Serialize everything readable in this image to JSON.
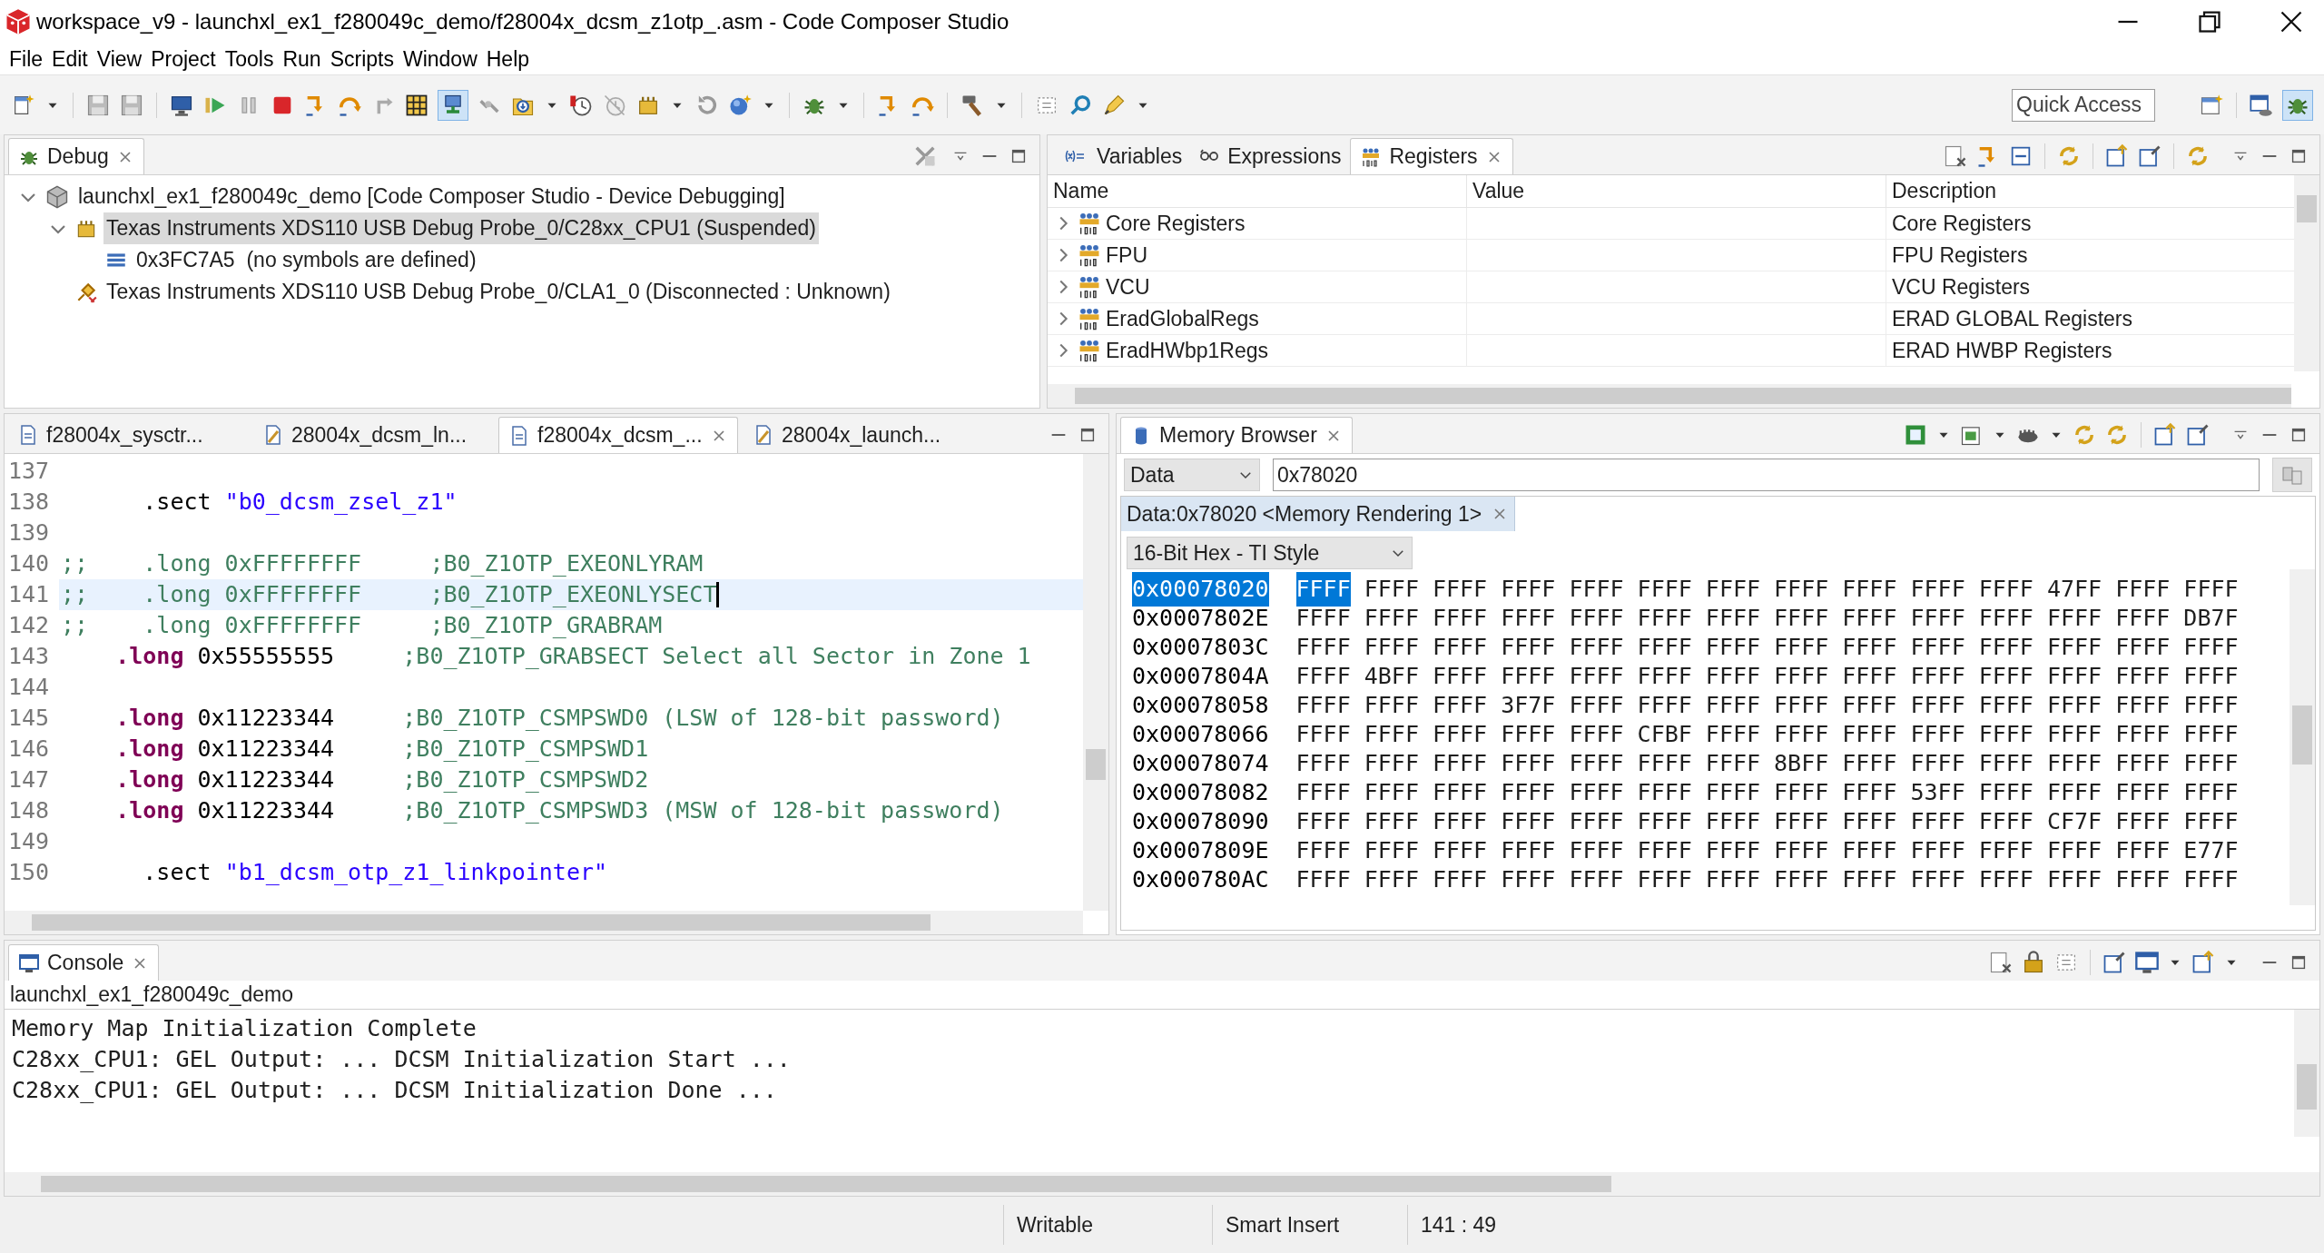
{
  "window": {
    "title": "workspace_v9 - launchxl_ex1_f280049c_demo/f28004x_dcsm_z1otp_.asm - Code Composer Studio"
  },
  "menu": [
    "File",
    "Edit",
    "View",
    "Project",
    "Tools",
    "Run",
    "Scripts",
    "Window",
    "Help"
  ],
  "quick_access": {
    "placeholder": "Quick Access"
  },
  "debug": {
    "tabs": [
      {
        "label": "Debug",
        "selected": true
      }
    ],
    "tree": [
      {
        "label": "launchxl_ex1_f280049c_demo [Code Composer Studio - Device Debugging]",
        "expanded": true,
        "selected": false,
        "children": [
          {
            "label": "Texas Instruments XDS110 USB Debug Probe_0/C28xx_CPU1 (Suspended)",
            "expanded": true,
            "selected": true,
            "children": [
              {
                "label": "0x3FC7A5  (no symbols are defined)",
                "selected": false
              }
            ]
          },
          {
            "label": "Texas Instruments XDS110 USB Debug Probe_0/CLA1_0 (Disconnected : Unknown)",
            "selected": false
          }
        ]
      }
    ]
  },
  "registers": {
    "tabs": [
      {
        "label": "Variables",
        "selected": false
      },
      {
        "label": "Expressions",
        "selected": false
      },
      {
        "label": "Registers",
        "selected": true
      }
    ],
    "columns": [
      "Name",
      "Value",
      "Description"
    ],
    "rows": [
      {
        "name": "Core Registers",
        "description": "Core Registers",
        "expanded": false
      },
      {
        "name": "FPU",
        "description": "FPU Registers",
        "expanded": false
      },
      {
        "name": "VCU",
        "description": "VCU Registers",
        "expanded": false
      },
      {
        "name": "EradGlobalRegs",
        "description": "ERAD GLOBAL Registers",
        "expanded": false
      },
      {
        "name": "EradHWbp1Regs",
        "description": "ERAD HWBP Registers",
        "expanded": false
      }
    ]
  },
  "editor": {
    "tabs": [
      {
        "label": "f28004x_sysctr...",
        "selected": false
      },
      {
        "label": "28004x_dcsm_ln...",
        "selected": false
      },
      {
        "label": "f28004x_dcsm_...",
        "selected": true
      },
      {
        "label": "28004x_launch...",
        "selected": false
      }
    ],
    "lines": [
      {
        "number": "137",
        "current": false
      },
      {
        "number": "138",
        "current": false,
        "parts": [
          {
            "kind": "plain",
            "text": "      .sect "
          },
          {
            "kind": "string",
            "text": "\"b0_dcsm_zsel_z1\""
          }
        ]
      },
      {
        "number": "139",
        "current": false
      },
      {
        "number": "140",
        "current": false,
        "parts": [
          {
            "kind": "comment",
            "text": ";;    .long 0xFFFFFFFF     ;B0_Z1OTP_EXEONLYRAM"
          }
        ]
      },
      {
        "number": "141",
        "current": true,
        "parts": [
          {
            "kind": "comment",
            "text": ";;    .long 0xFFFFFFFF     ;B0_Z1OTP_EXEONLYSECT"
          }
        ]
      },
      {
        "number": "142",
        "current": false,
        "parts": [
          {
            "kind": "comment",
            "text": ";;    .long 0xFFFFFFFF     ;B0_Z1OTP_GRABRAM"
          }
        ]
      },
      {
        "number": "143",
        "current": false,
        "parts": [
          {
            "kind": "keyword",
            "text": "    .long"
          },
          {
            "kind": "plain",
            "text": " 0x55555555     "
          },
          {
            "kind": "comment",
            "text": ";B0_Z1OTP_GRABSECT Select all Sector in Zone 1"
          }
        ]
      },
      {
        "number": "144",
        "current": false
      },
      {
        "number": "145",
        "current": false,
        "parts": [
          {
            "kind": "keyword",
            "text": "    .long"
          },
          {
            "kind": "plain",
            "text": " 0x11223344     "
          },
          {
            "kind": "comment",
            "text": ";B0_Z1OTP_CSMPSWD0 (LSW of 128-bit password)"
          }
        ]
      },
      {
        "number": "146",
        "current": false,
        "parts": [
          {
            "kind": "keyword",
            "text": "    .long"
          },
          {
            "kind": "plain",
            "text": " 0x11223344     "
          },
          {
            "kind": "comment",
            "text": ";B0_Z1OTP_CSMPSWD1"
          }
        ]
      },
      {
        "number": "147",
        "current": false,
        "parts": [
          {
            "kind": "keyword",
            "text": "    .long"
          },
          {
            "kind": "plain",
            "text": " 0x11223344     "
          },
          {
            "kind": "comment",
            "text": ";B0_Z1OTP_CSMPSWD2"
          }
        ]
      },
      {
        "number": "148",
        "current": false,
        "parts": [
          {
            "kind": "keyword",
            "text": "    .long"
          },
          {
            "kind": "plain",
            "text": " 0x11223344     "
          },
          {
            "kind": "comment",
            "text": ";B0_Z1OTP_CSMPSWD3 (MSW of 128-bit password)"
          }
        ]
      },
      {
        "number": "149",
        "current": false
      },
      {
        "number": "150",
        "current": false,
        "parts": [
          {
            "kind": "plain",
            "text": "      .sect "
          },
          {
            "kind": "string",
            "text": "\"b1_dcsm_otp_z1_linkpointer\""
          }
        ]
      }
    ]
  },
  "memory": {
    "tabs": [
      {
        "label": "Memory Browser",
        "selected": true
      }
    ],
    "space": "Data",
    "address": "0x78020",
    "rendering_tabs": [
      {
        "label": "Data:0x78020 <Memory Rendering 1>",
        "selected": true
      }
    ],
    "format": "16-Bit Hex - TI Style",
    "rows": [
      {
        "address": "0x00078020",
        "selected": true,
        "values": [
          "FFFF",
          "FFFF",
          "FFFF",
          "FFFF",
          "FFFF",
          "FFFF",
          "FFFF",
          "FFFF",
          "FFFF",
          "FFFF",
          "FFFF",
          "47FF",
          "FFFF",
          "FFFF"
        ]
      },
      {
        "address": "0x0007802E",
        "selected": false,
        "values": [
          "FFFF",
          "FFFF",
          "FFFF",
          "FFFF",
          "FFFF",
          "FFFF",
          "FFFF",
          "FFFF",
          "FFFF",
          "FFFF",
          "FFFF",
          "FFFF",
          "FFFF",
          "DB7F"
        ]
      },
      {
        "address": "0x0007803C",
        "selected": false,
        "values": [
          "FFFF",
          "FFFF",
          "FFFF",
          "FFFF",
          "FFFF",
          "FFFF",
          "FFFF",
          "FFFF",
          "FFFF",
          "FFFF",
          "FFFF",
          "FFFF",
          "FFFF",
          "FFFF"
        ]
      },
      {
        "address": "0x0007804A",
        "selected": false,
        "values": [
          "FFFF",
          "4BFF",
          "FFFF",
          "FFFF",
          "FFFF",
          "FFFF",
          "FFFF",
          "FFFF",
          "FFFF",
          "FFFF",
          "FFFF",
          "FFFF",
          "FFFF",
          "FFFF"
        ]
      },
      {
        "address": "0x00078058",
        "selected": false,
        "values": [
          "FFFF",
          "FFFF",
          "FFFF",
          "3F7F",
          "FFFF",
          "FFFF",
          "FFFF",
          "FFFF",
          "FFFF",
          "FFFF",
          "FFFF",
          "FFFF",
          "FFFF",
          "FFFF"
        ]
      },
      {
        "address": "0x00078066",
        "selected": false,
        "values": [
          "FFFF",
          "FFFF",
          "FFFF",
          "FFFF",
          "FFFF",
          "CFBF",
          "FFFF",
          "FFFF",
          "FFFF",
          "FFFF",
          "FFFF",
          "FFFF",
          "FFFF",
          "FFFF"
        ]
      },
      {
        "address": "0x00078074",
        "selected": false,
        "values": [
          "FFFF",
          "FFFF",
          "FFFF",
          "FFFF",
          "FFFF",
          "FFFF",
          "FFFF",
          "8BFF",
          "FFFF",
          "FFFF",
          "FFFF",
          "FFFF",
          "FFFF",
          "FFFF"
        ]
      },
      {
        "address": "0x00078082",
        "selected": false,
        "values": [
          "FFFF",
          "FFFF",
          "FFFF",
          "FFFF",
          "FFFF",
          "FFFF",
          "FFFF",
          "FFFF",
          "FFFF",
          "53FF",
          "FFFF",
          "FFFF",
          "FFFF",
          "FFFF"
        ]
      },
      {
        "address": "0x00078090",
        "selected": false,
        "values": [
          "FFFF",
          "FFFF",
          "FFFF",
          "FFFF",
          "FFFF",
          "FFFF",
          "FFFF",
          "FFFF",
          "FFFF",
          "FFFF",
          "FFFF",
          "CF7F",
          "FFFF",
          "FFFF"
        ]
      },
      {
        "address": "0x0007809E",
        "selected": false,
        "values": [
          "FFFF",
          "FFFF",
          "FFFF",
          "FFFF",
          "FFFF",
          "FFFF",
          "FFFF",
          "FFFF",
          "FFFF",
          "FFFF",
          "FFFF",
          "FFFF",
          "FFFF",
          "E77F"
        ]
      },
      {
        "address": "0x000780AC",
        "selected": false,
        "values": [
          "FFFF",
          "FFFF",
          "FFFF",
          "FFFF",
          "FFFF",
          "FFFF",
          "FFFF",
          "FFFF",
          "FFFF",
          "FFFF",
          "FFFF",
          "FFFF",
          "FFFF",
          "FFFF"
        ]
      }
    ]
  },
  "console": {
    "tabs": [
      {
        "label": "Console",
        "selected": true
      }
    ],
    "title": "launchxl_ex1_f280049c_demo",
    "lines": [
      "Memory Map Initialization Complete",
      "C28xx_CPU1: GEL Output: ... DCSM Initialization Start ...",
      "C28xx_CPU1: GEL Output: ... DCSM Initialization Done ..."
    ]
  },
  "status_bar": [
    "Writable",
    "Smart Insert",
    "141 : 49"
  ]
}
